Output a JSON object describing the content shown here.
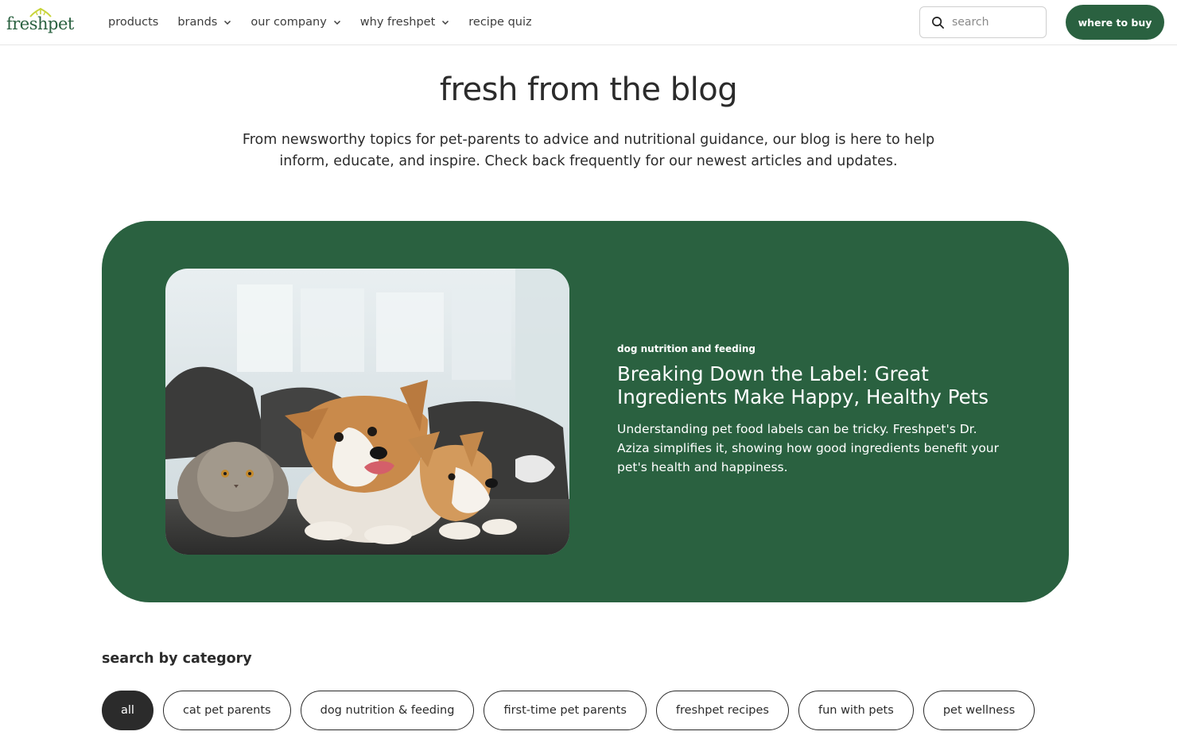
{
  "header": {
    "logo_text": "freshpet",
    "nav": [
      {
        "label": "products",
        "has_dropdown": false
      },
      {
        "label": "brands",
        "has_dropdown": true
      },
      {
        "label": "our company",
        "has_dropdown": true
      },
      {
        "label": "why freshpet",
        "has_dropdown": true
      },
      {
        "label": "recipe quiz",
        "has_dropdown": false
      }
    ],
    "search_placeholder": "search",
    "cta_label": "where to buy"
  },
  "hero": {
    "title": "fresh from the blog",
    "intro": "From newsworthy topics for pet-parents to advice and nutritional guidance, our blog is here to help inform, educate, and inspire. Check back frequently for our newest articles and updates."
  },
  "featured": {
    "category": "dog nutrition and feeding",
    "title": "Breaking Down the Label: Great Ingredients Make Happy, Healthy Pets",
    "description": "Understanding pet food labels can be tricky. Freshpet's Dr. Aziza simplifies it, showing how good ingredients benefit your pet's health and happiness."
  },
  "categories": {
    "heading": "search by category",
    "items": [
      {
        "label": "all",
        "active": true
      },
      {
        "label": "cat pet parents",
        "active": false
      },
      {
        "label": "dog nutrition & feeding",
        "active": false
      },
      {
        "label": "first-time pet parents",
        "active": false
      },
      {
        "label": "freshpet recipes",
        "active": false
      },
      {
        "label": "fun with pets",
        "active": false
      },
      {
        "label": "pet wellness",
        "active": false
      }
    ]
  },
  "colors": {
    "brand_green": "#2a6140",
    "text_dark": "#2b2b2b",
    "chip_active_bg": "#2b2b2b"
  }
}
